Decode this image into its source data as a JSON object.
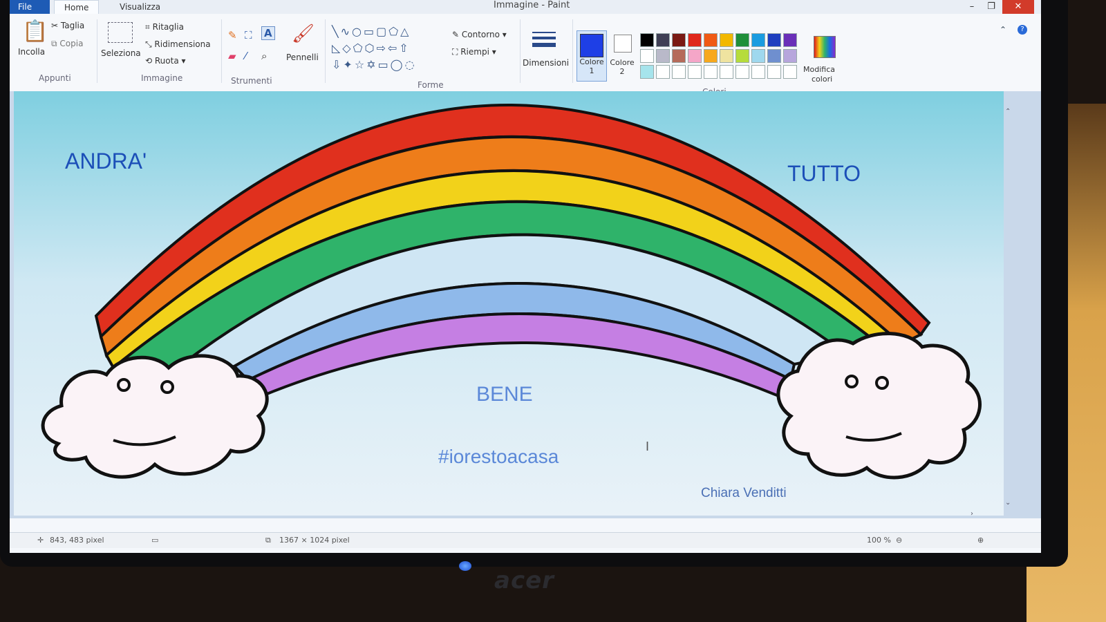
{
  "window": {
    "title": "Immagine - Paint"
  },
  "tabs": {
    "file": "File",
    "home": "Home",
    "view": "Visualizza"
  },
  "window_controls": {
    "minimize": "–",
    "restore": "❐",
    "close": "✕"
  },
  "ribbon": {
    "clipboard": {
      "paste": "Incolla",
      "cut": "Taglia",
      "copy": "Copia",
      "group": "Appunti"
    },
    "image": {
      "select": "Seleziona",
      "crop": "Ritaglia",
      "resize": "Ridimensiona",
      "rotate": "Ruota",
      "group": "Immagine"
    },
    "tools": {
      "group": "Strumenti"
    },
    "brushes": {
      "label": "Pennelli"
    },
    "shapes": {
      "outline": "Contorno",
      "fill": "Riempi",
      "group": "Forme"
    },
    "size": {
      "label": "Dimensioni"
    },
    "colors": {
      "color1": "Colore",
      "color1_num": "1",
      "color2": "Colore",
      "color2_num": "2",
      "edit": "Modifica",
      "edit2": "colori",
      "group": "Colori"
    },
    "palette_row1": [
      "#000000",
      "#3f3f55",
      "#7a1a14",
      "#e0281c",
      "#f05a14",
      "#f2b800",
      "#1f8f3a",
      "#1a9ce0",
      "#1e3fbf",
      "#6a30b8"
    ],
    "palette_row2": [
      "#ffffff",
      "#b9b9c9",
      "#b56a5a",
      "#f5a6c8",
      "#f7a81e",
      "#efe3a0",
      "#b6dc3c",
      "#9fd8ee",
      "#6f8fcf",
      "#b7a6dc"
    ],
    "palette_row3": [
      "#a6e4ec",
      "#ffffff",
      "#ffffff",
      "#ffffff",
      "#ffffff",
      "#ffffff",
      "#ffffff",
      "#ffffff",
      "#ffffff",
      "#ffffff"
    ],
    "active_color": "#1e3fe6"
  },
  "drawing": {
    "word1": "ANDRA'",
    "word2": "TUTTO",
    "word3": "BENE",
    "hashtag": "#iorestoacasa",
    "author": "Chiara Venditti",
    "rainbow_colors": [
      "#e0301e",
      "#ee7d1a",
      "#f2d21a",
      "#2fb36a",
      "#cfe6f4",
      "#8fb9ea",
      "#c57fe3"
    ]
  },
  "status": {
    "cursor": "843, 483 pixel",
    "size": "1367 × 1024 pixel",
    "zoom": "100 %"
  },
  "monitor": {
    "brand": "acer"
  }
}
